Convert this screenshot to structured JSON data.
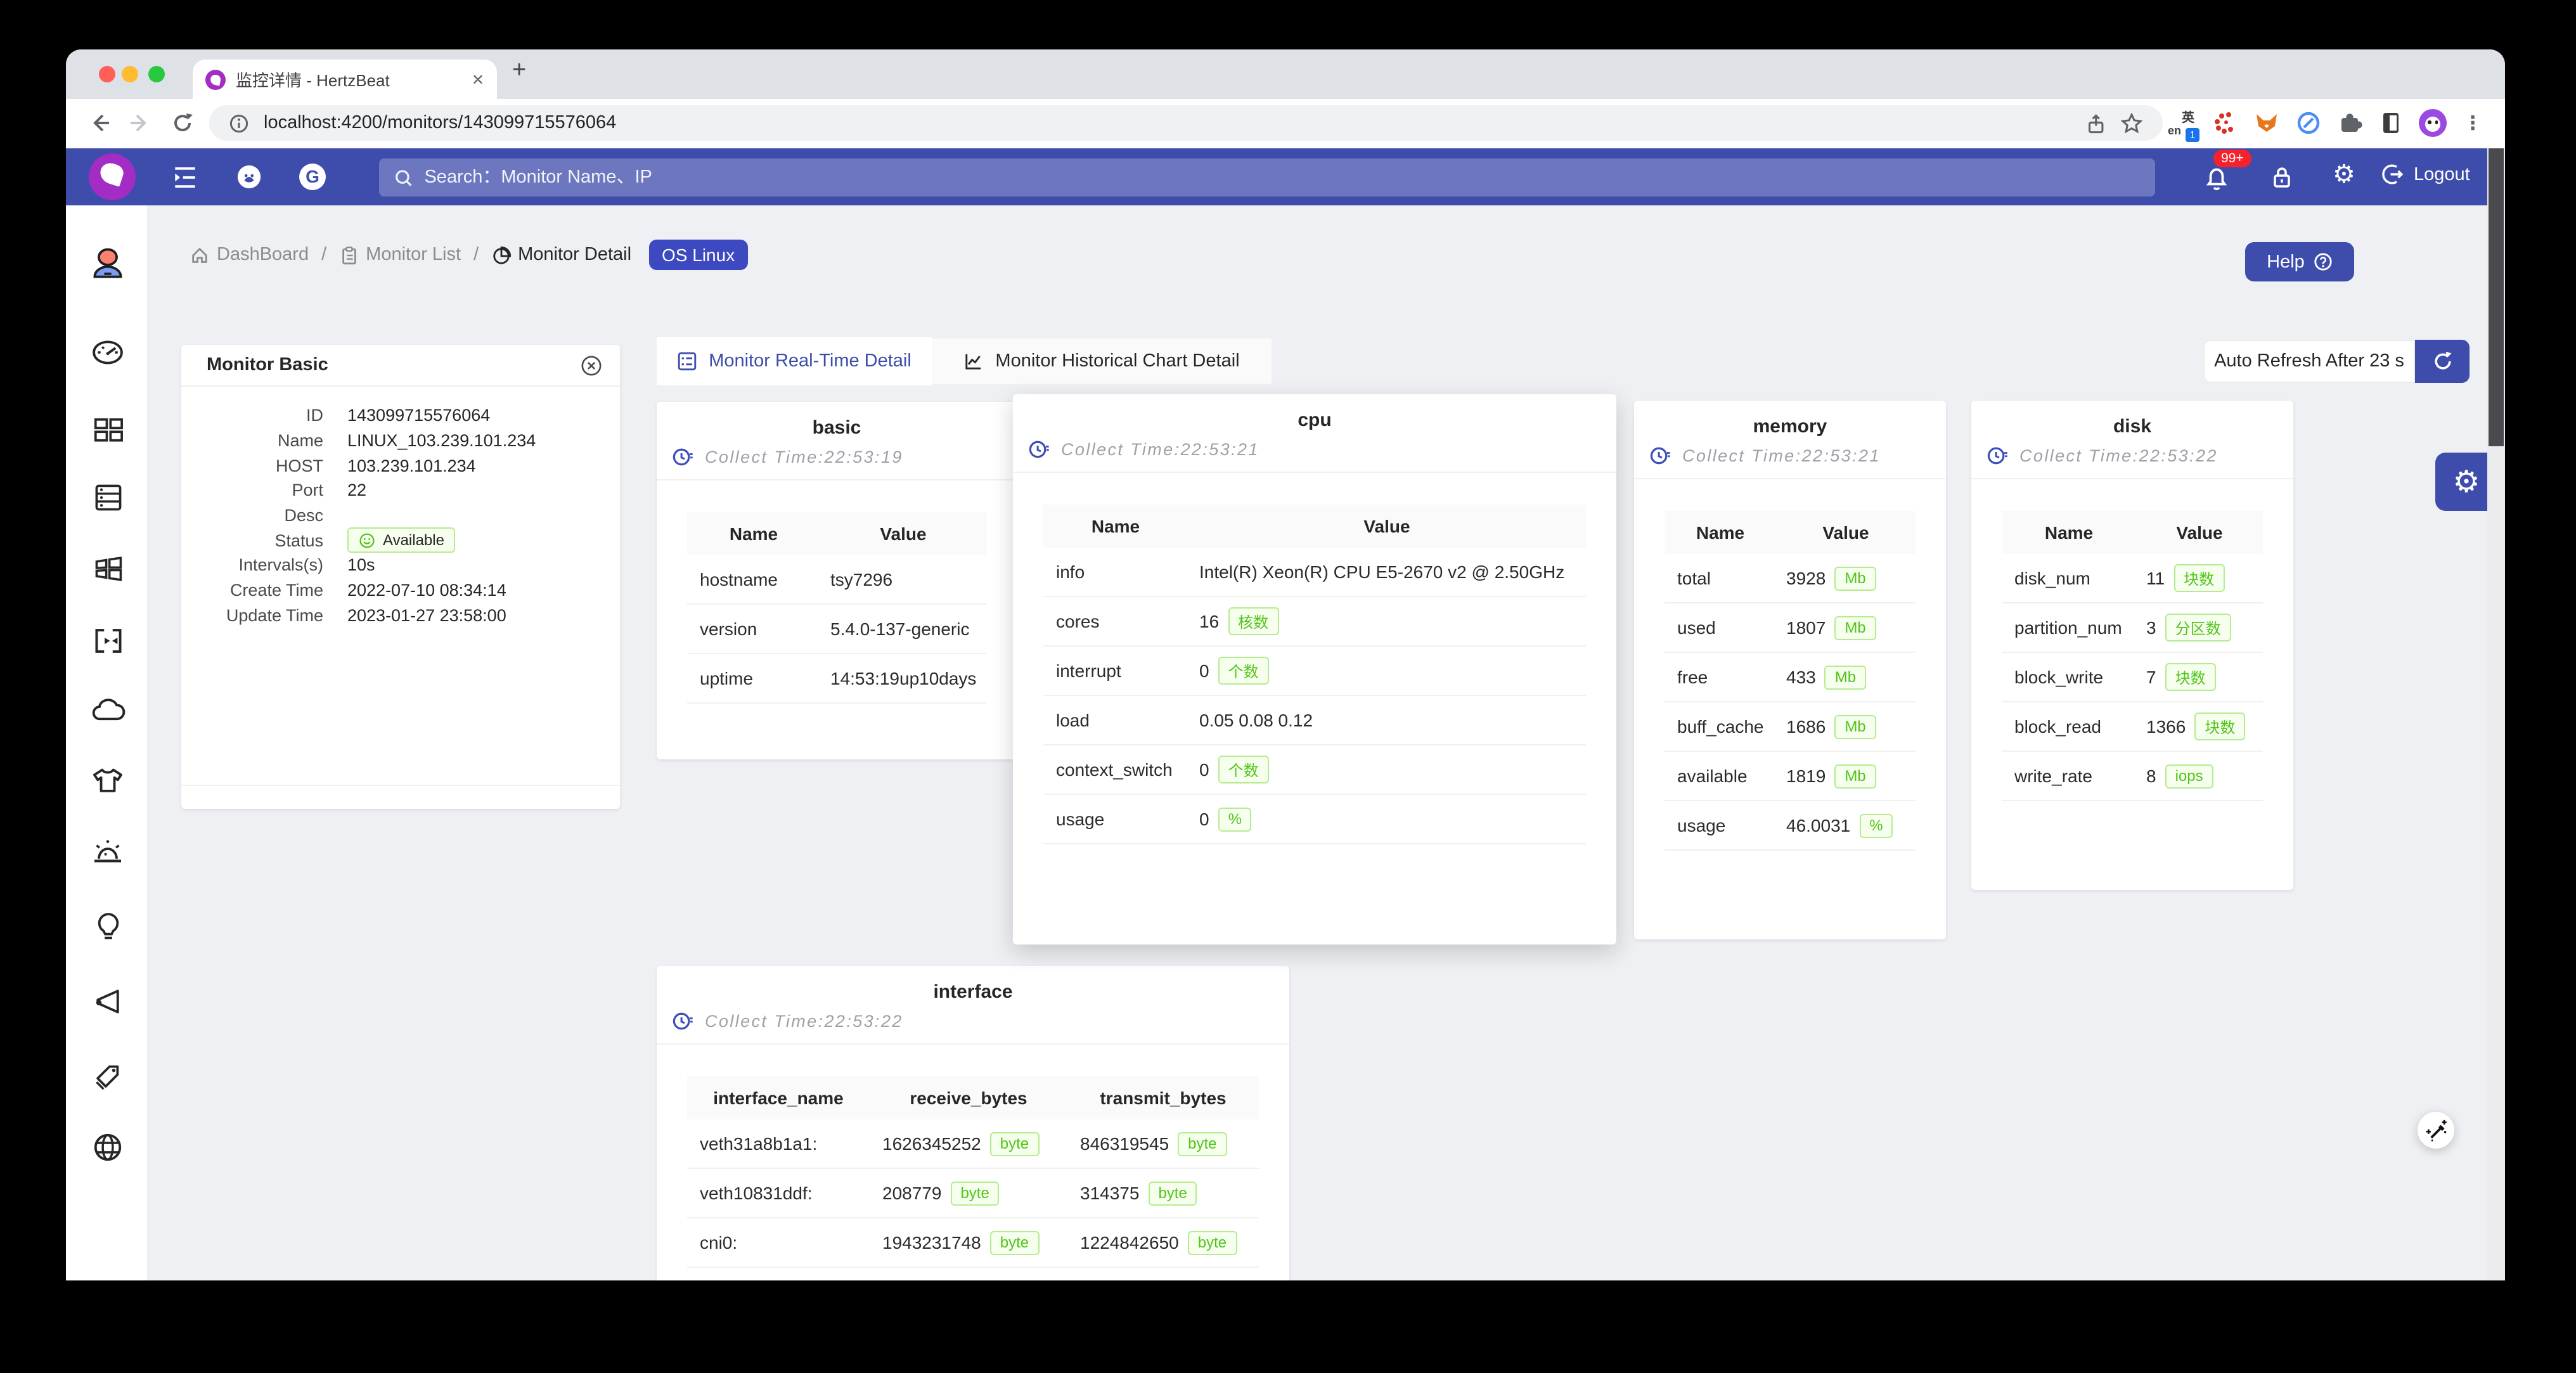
{
  "colors": {
    "accent": "#3e4dab",
    "green": "#52c41a",
    "green_border": "#b7eb8f",
    "green_bg": "#f6ffed",
    "badge_red": "#f5222d"
  },
  "browser": {
    "tab_title": "监控详情 - HertzBeat",
    "url": "localhost:4200/monitors/143099715576064",
    "close_glyph": "✕",
    "newtab_glyph": "+",
    "menu_glyph": "⋮",
    "translate_zh": "英",
    "translate_en": "en",
    "translate_badge": "1"
  },
  "navbar": {
    "search_placeholder": "Search：Monitor Name、IP",
    "notification_count": "99+",
    "logout_label": "Logout",
    "gitee_letter": "G",
    "gear_glyph": "⚙"
  },
  "breadcrumb": {
    "dashboard": "DashBoard",
    "monitor_list": "Monitor List",
    "monitor_detail": "Monitor Detail",
    "separator": "/",
    "monitor_type": "OS Linux"
  },
  "help_label": "Help",
  "basic_panel": {
    "title": "Monitor Basic",
    "fields": [
      {
        "label": "ID",
        "value": "143099715576064"
      },
      {
        "label": "Name",
        "value": "LINUX_103.239.101.234"
      },
      {
        "label": "HOST",
        "value": "103.239.101.234"
      },
      {
        "label": "Port",
        "value": "22"
      },
      {
        "label": "Desc",
        "value": ""
      },
      {
        "label": "Status",
        "value": "Available",
        "status": true
      },
      {
        "label": "Intervals(s)",
        "value": "10s"
      },
      {
        "label": "Create Time",
        "value": "2022-07-10 08:34:14"
      },
      {
        "label": "Update Time",
        "value": "2023-01-27 23:58:00"
      }
    ]
  },
  "tabs": {
    "realtime": "Monitor Real-Time Detail",
    "historical": "Monitor Historical Chart Detail"
  },
  "auto_refresh_label": "Auto Refresh After 23 s",
  "cards": [
    {
      "id": "basic",
      "title": "basic",
      "collect": "Collect Time:22:53:19",
      "headers": [
        "Name",
        "Value"
      ],
      "rows": [
        {
          "name": "hostname",
          "value": "tsy7296"
        },
        {
          "name": "version",
          "value": "5.4.0-137-generic"
        },
        {
          "name": "uptime",
          "value": "14:53:19up10days"
        }
      ]
    },
    {
      "id": "cpu",
      "title": "cpu",
      "collect": "Collect Time:22:53:21",
      "headers": [
        "Name",
        "Value"
      ],
      "rows": [
        {
          "name": "info",
          "value": "Intel(R) Xeon(R) CPU E5-2670 v2 @ 2.50GHz"
        },
        {
          "name": "cores",
          "value": "16",
          "badge": "核数"
        },
        {
          "name": "interrupt",
          "value": "0",
          "badge": "个数"
        },
        {
          "name": "load",
          "value": "0.05 0.08 0.12"
        },
        {
          "name": "context_switch",
          "value": "0",
          "badge": "个数"
        },
        {
          "name": "usage",
          "value": "0",
          "badge": "%"
        }
      ]
    },
    {
      "id": "memory",
      "title": "memory",
      "collect": "Collect Time:22:53:21",
      "headers": [
        "Name",
        "Value"
      ],
      "rows": [
        {
          "name": "total",
          "value": "3928",
          "badge": "Mb"
        },
        {
          "name": "used",
          "value": "1807",
          "badge": "Mb"
        },
        {
          "name": "free",
          "value": "433",
          "badge": "Mb"
        },
        {
          "name": "buff_cache",
          "value": "1686",
          "badge": "Mb"
        },
        {
          "name": "available",
          "value": "1819",
          "badge": "Mb"
        },
        {
          "name": "usage",
          "value": "46.0031",
          "badge": "%"
        }
      ]
    },
    {
      "id": "disk",
      "title": "disk",
      "collect": "Collect Time:22:53:22",
      "headers": [
        "Name",
        "Value"
      ],
      "rows": [
        {
          "name": "disk_num",
          "value": "11",
          "badge": "块数"
        },
        {
          "name": "partition_num",
          "value": "3",
          "badge": "分区数"
        },
        {
          "name": "block_write",
          "value": "7",
          "badge": "块数"
        },
        {
          "name": "block_read",
          "value": "1366",
          "badge": "块数"
        },
        {
          "name": "write_rate",
          "value": "8",
          "badge": "iops"
        }
      ]
    }
  ],
  "interface_card": {
    "id": "interface",
    "title": "interface",
    "collect": "Collect Time:22:53:22",
    "headers": [
      "interface_name",
      "receive_bytes",
      "transmit_bytes"
    ],
    "rows": [
      {
        "name": "veth31a8b1a1:",
        "receive": "1626345252",
        "receive_badge": "byte",
        "transmit": "846319545",
        "transmit_badge": "byte"
      },
      {
        "name": "veth10831ddf:",
        "receive": "208779",
        "receive_badge": "byte",
        "transmit": "314375",
        "transmit_badge": "byte"
      },
      {
        "name": "cni0:",
        "receive": "1943231748",
        "receive_badge": "byte",
        "transmit": "1224842650",
        "transmit_badge": "byte"
      }
    ]
  }
}
